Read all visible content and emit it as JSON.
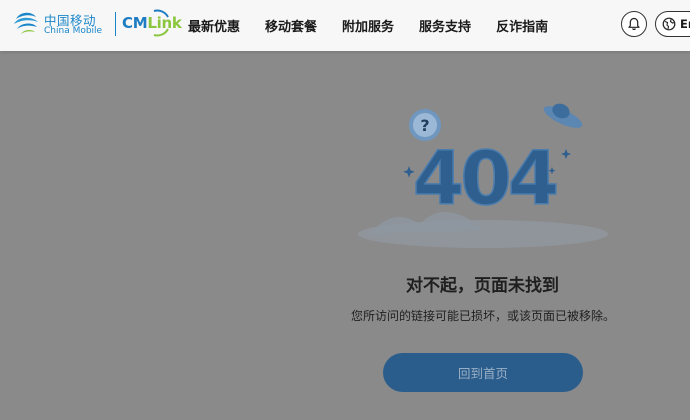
{
  "header": {
    "logo_cn": "中国移动",
    "logo_en": "China Mobile",
    "cmlink_cm": "CM",
    "cmlink_link": "Link",
    "nav": [
      {
        "label": "最新优惠"
      },
      {
        "label": "移动套餐"
      },
      {
        "label": "附加服务"
      },
      {
        "label": "服务支持"
      },
      {
        "label": "反诈指南"
      }
    ],
    "language_label": "En",
    "icons": {
      "bell": "bell-icon",
      "language": "globe-icon"
    }
  },
  "error": {
    "code": "404",
    "question_mark": "?",
    "title": "对不起，页面未找到",
    "description": "您所访问的链接可能已损坏，或该页面已被移除。",
    "home_button": "回到首页"
  },
  "colors": {
    "brand_blue": "#1a86c8",
    "brand_green": "#8cc63f",
    "overlay": "#8a8a8a",
    "button": "#2b5d8c"
  }
}
